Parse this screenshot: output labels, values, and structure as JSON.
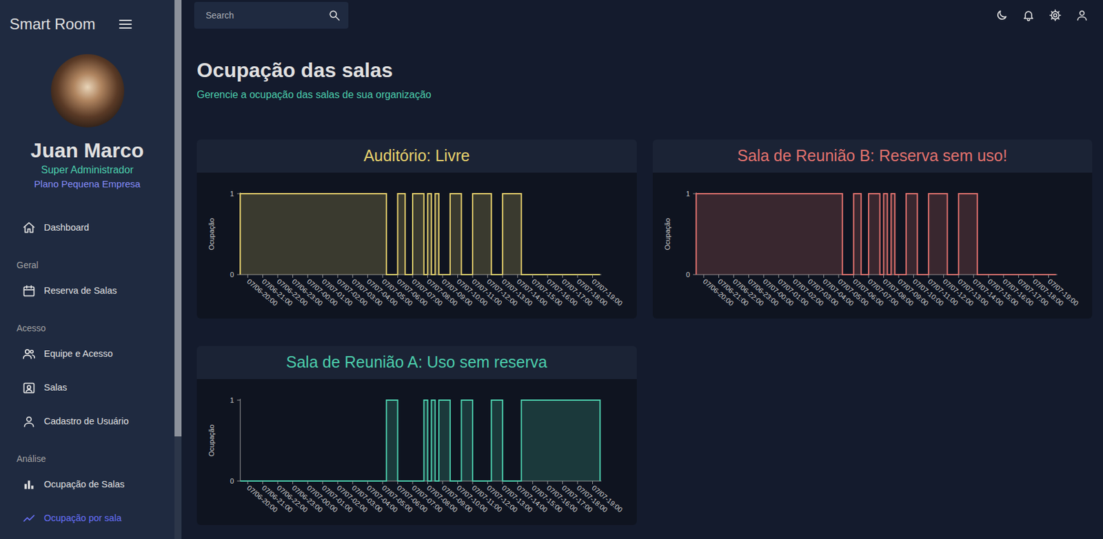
{
  "sidebar": {
    "brand": "Smart Room",
    "user": {
      "name": "Juan Marco",
      "role": "Super Administrador",
      "plan": "Plano Pequena Empresa"
    },
    "scrollbar": {
      "level": 0.81
    },
    "nav": [
      {
        "heading": "",
        "items": [
          {
            "label": "Dashboard",
            "selected": false
          }
        ]
      },
      {
        "heading": "Geral",
        "items": [
          {
            "label": "Reserva de Salas",
            "selected": false
          }
        ]
      },
      {
        "heading": "Acesso",
        "items": [
          {
            "label": "Equipe e Acesso",
            "selected": false
          },
          {
            "label": "Salas",
            "selected": false
          },
          {
            "label": "Cadastro de Usuário",
            "selected": false
          }
        ]
      },
      {
        "heading": "Análise",
        "items": [
          {
            "label": "Ocupação de Salas",
            "selected": false
          },
          {
            "label": "Ocupação por sala",
            "selected": true
          }
        ]
      }
    ]
  },
  "search": {
    "placeholder": "Search"
  },
  "page": {
    "title": "Ocupação das salas",
    "subtitle": "Gerencie a ocupação das salas de sua organização"
  },
  "charts": [
    {
      "title": "Auditório: Livre",
      "color": "#e8d26d",
      "y_label": "Ocupação",
      "y_ticks": [
        "1",
        "0"
      ],
      "x_ticks": [
        "07/06-20:00",
        "07/06-21:00",
        "07/06-22:00",
        "07/06-23:00",
        "07/07-00:00",
        "07/07-01:00",
        "07/07-02:00",
        "07/07-03:00",
        "07/07-04:00",
        "07/07-05:00",
        "07/07-06:00",
        "07/07-07:00",
        "07/07-08:00",
        "07/07-09:00",
        "07/07-10:00",
        "07/07-11:00",
        "07/07-12:00",
        "07/07-13:00",
        "07/07-14:00",
        "07/07-15:00",
        "07/07-16:00",
        "07/07-17:00",
        "07/07-18:00",
        "07/07-19:00"
      ],
      "values": [
        1,
        1,
        1,
        1,
        1,
        1,
        1,
        1,
        1,
        1,
        1,
        1,
        1,
        1,
        1,
        1,
        1,
        1,
        1,
        1,
        1,
        1,
        1,
        1,
        1,
        1,
        1,
        1,
        1,
        1,
        1,
        1,
        1,
        1,
        1,
        1,
        1,
        1,
        1,
        0,
        0,
        0,
        1,
        1,
        0,
        0,
        1,
        1,
        1,
        0,
        1,
        0,
        1,
        0,
        0,
        0,
        1,
        1,
        1,
        0,
        0,
        0,
        1,
        1,
        1,
        1,
        1,
        0,
        0,
        0,
        1,
        1,
        1,
        1,
        1,
        0,
        0,
        0,
        0,
        0,
        0,
        0,
        0,
        0,
        0,
        0,
        0,
        0,
        0,
        0,
        0,
        0,
        0,
        0,
        0,
        0
      ]
    },
    {
      "title": "Sala de Reunião B: Reserva sem uso!",
      "color": "#e2726e",
      "y_label": "Ocupação",
      "y_ticks": [
        "1",
        "0"
      ],
      "x_ticks": [
        "07/06-20:00",
        "07/06-21:00",
        "07/06-22:00",
        "07/06-23:00",
        "07/07-00:00",
        "07/07-01:00",
        "07/07-02:00",
        "07/07-03:00",
        "07/07-04:00",
        "07/07-05:00",
        "07/07-06:00",
        "07/07-07:00",
        "07/07-08:00",
        "07/07-09:00",
        "07/07-10:00",
        "07/07-11:00",
        "07/07-12:00",
        "07/07-13:00",
        "07/07-14:00",
        "07/07-15:00",
        "07/07-16:00",
        "07/07-17:00",
        "07/07-18:00",
        "07/07-19:00"
      ],
      "values": [
        1,
        1,
        1,
        1,
        1,
        1,
        1,
        1,
        1,
        1,
        1,
        1,
        1,
        1,
        1,
        1,
        1,
        1,
        1,
        1,
        1,
        1,
        1,
        1,
        1,
        1,
        1,
        1,
        1,
        1,
        1,
        1,
        1,
        1,
        1,
        1,
        1,
        1,
        1,
        0,
        0,
        0,
        1,
        1,
        0,
        0,
        1,
        1,
        1,
        0,
        1,
        0,
        1,
        0,
        0,
        0,
        1,
        1,
        1,
        0,
        0,
        0,
        1,
        1,
        1,
        1,
        1,
        0,
        0,
        0,
        1,
        1,
        1,
        1,
        1,
        0,
        0,
        0,
        0,
        0,
        0,
        0,
        0,
        0,
        0,
        0,
        0,
        0,
        0,
        0,
        0,
        0,
        0,
        0,
        0,
        0
      ]
    },
    {
      "title": "Sala de Reunião A: Uso sem reserva",
      "color": "#4cceac",
      "y_label": "Ocupação",
      "y_ticks": [
        "1",
        "0"
      ],
      "x_ticks": [
        "07/06-20:00",
        "07/06-21:00",
        "07/06-22:00",
        "07/06-23:00",
        "07/07-00:00",
        "07/07-01:00",
        "07/07-02:00",
        "07/07-03:00",
        "07/07-04:00",
        "07/07-05:00",
        "07/07-06:00",
        "07/07-07:00",
        "07/07-08:00",
        "07/07-09:00",
        "07/07-10:00",
        "07/07-11:00",
        "07/07-12:00",
        "07/07-13:00",
        "07/07-14:00",
        "07/07-15:00",
        "07/07-16:00",
        "07/07-17:00",
        "07/07-18:00",
        "07/07-19:00"
      ],
      "values": [
        0,
        0,
        0,
        0,
        0,
        0,
        0,
        0,
        0,
        0,
        0,
        0,
        0,
        0,
        0,
        0,
        0,
        0,
        0,
        0,
        0,
        0,
        0,
        0,
        0,
        0,
        0,
        0,
        0,
        0,
        0,
        0,
        0,
        0,
        0,
        0,
        0,
        0,
        0,
        1,
        1,
        1,
        0,
        0,
        0,
        0,
        0,
        0,
        0,
        1,
        0,
        1,
        0,
        1,
        1,
        1,
        0,
        0,
        0,
        1,
        1,
        1,
        0,
        0,
        0,
        0,
        0,
        1,
        1,
        1,
        0,
        0,
        0,
        0,
        0,
        1,
        1,
        1,
        1,
        1,
        1,
        1,
        1,
        1,
        1,
        1,
        1,
        1,
        1,
        1,
        1,
        1,
        1,
        1,
        1,
        1
      ]
    }
  ]
}
